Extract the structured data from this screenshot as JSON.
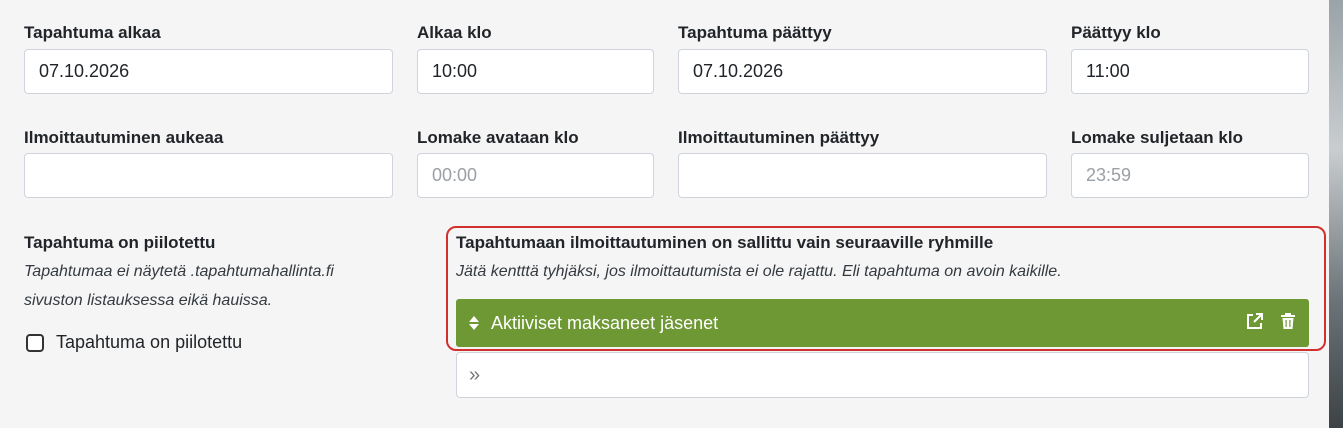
{
  "event_start": {
    "label": "Tapahtuma alkaa",
    "value": "07.10.2026"
  },
  "start_time": {
    "label": "Alkaa klo",
    "value": "10:00"
  },
  "event_end": {
    "label": "Tapahtuma päättyy",
    "value": "07.10.2026"
  },
  "end_time": {
    "label": "Päättyy klo",
    "value": "11:00"
  },
  "registration_opens": {
    "label": "Ilmoittautuminen aukeaa",
    "value": ""
  },
  "form_open_time": {
    "label": "Lomake avataan klo",
    "placeholder": "00:00"
  },
  "registration_closes": {
    "label": "Ilmoittautuminen päättyy",
    "value": ""
  },
  "form_close_time": {
    "label": "Lomake suljetaan klo",
    "placeholder": "23:59"
  },
  "hidden": {
    "title": "Tapahtuma on piilotettu",
    "description_line1": "Tapahtumaa ei näytetä .tapahtumahallinta.fi",
    "description_line2": "sivuston listauksessa eikä hauissa.",
    "checkbox_label": "Tapahtuma on piilotettu",
    "checked": false
  },
  "groups": {
    "title": "Tapahtumaan ilmoittautuminen on sallittu vain seuraaville ryhmille",
    "description": "Jätä kentttä tyhjäksi, jos ilmoittautumista ei ole rajattu. Eli tapahtuma on avoin kaikille.",
    "items": [
      {
        "label": "Aktiiviset maksaneet jäsenet"
      }
    ],
    "add_icon": "»",
    "bar_color": "#6d9834",
    "highlight_color": "#d0312d"
  }
}
